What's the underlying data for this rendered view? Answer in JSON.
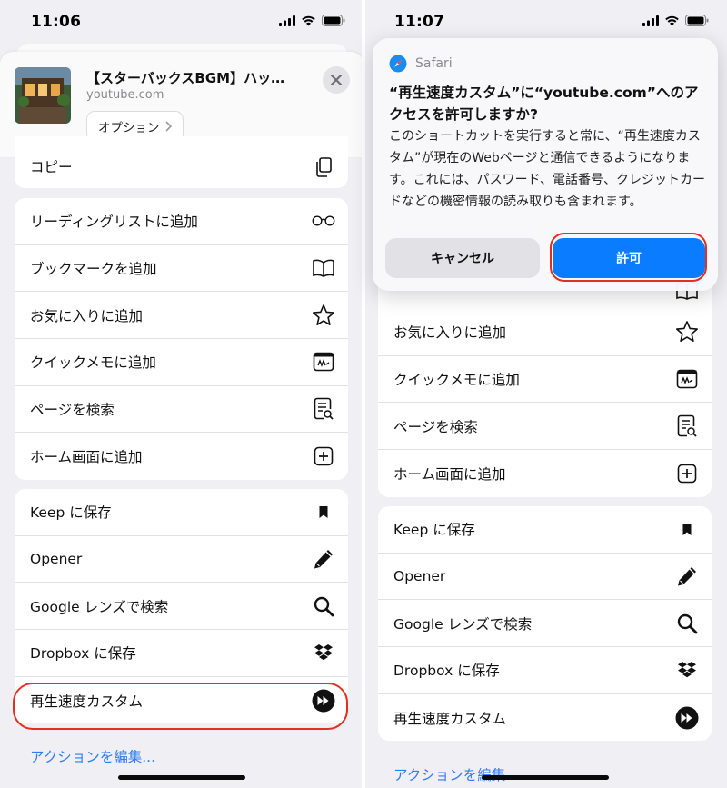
{
  "left": {
    "status": {
      "time": "11:06"
    },
    "header": {
      "title": "【スターバックスBGM】ハッピ…",
      "domain": "youtube.com",
      "options_label": "オプション"
    },
    "copy_label": "コピー",
    "group1": [
      {
        "label": "リーディングリストに追加",
        "icon": "glasses-icon"
      },
      {
        "label": "ブックマークを追加",
        "icon": "book-icon"
      },
      {
        "label": "お気に入りに追加",
        "icon": "star-icon"
      },
      {
        "label": "クイックメモに追加",
        "icon": "quick-note-icon"
      },
      {
        "label": "ページを検索",
        "icon": "find-on-page-icon"
      },
      {
        "label": "ホーム画面に追加",
        "icon": "add-square-icon"
      }
    ],
    "group2": [
      {
        "label": "Keep に保存",
        "icon": "bookmark-filled-icon"
      },
      {
        "label": "Opener",
        "icon": "pencil-icon"
      },
      {
        "label": "Google レンズで検索",
        "icon": "search-icon"
      },
      {
        "label": "Dropbox に保存",
        "icon": "dropbox-icon"
      },
      {
        "label": "再生速度カスタム",
        "icon": "fast-forward-circle-icon"
      }
    ],
    "edit_actions": "アクションを編集..."
  },
  "right": {
    "status": {
      "time": "11:07"
    },
    "dialog": {
      "app_name": "Safari",
      "title": "“再生速度カスタム”に“youtube.com”へのアクセスを許可しますか?",
      "body": "このショートカットを実行すると常に、“再生速度カスタム”が現在のWebページと通信できるようになります。これには、パスワード、電話番号、クレジットカードなどの機密情報の読み取りも含まれます。",
      "cancel_label": "キャンセル",
      "allow_label": "許可"
    },
    "group1": [
      {
        "label": "お気に入りに追加",
        "icon": "star-icon"
      },
      {
        "label": "クイックメモに追加",
        "icon": "quick-note-icon"
      },
      {
        "label": "ページを検索",
        "icon": "find-on-page-icon"
      },
      {
        "label": "ホーム画面に追加",
        "icon": "add-square-icon"
      }
    ],
    "group2": [
      {
        "label": "Keep に保存",
        "icon": "bookmark-filled-icon"
      },
      {
        "label": "Opener",
        "icon": "pencil-icon"
      },
      {
        "label": "Google レンズで検索",
        "icon": "search-icon"
      },
      {
        "label": "Dropbox に保存",
        "icon": "dropbox-icon"
      },
      {
        "label": "再生速度カスタム",
        "icon": "fast-forward-circle-icon"
      }
    ],
    "edit_actions": "アクションを編集..."
  },
  "colors": {
    "accent": "#0a7cff",
    "link": "#2f7cf6",
    "highlight": "#e0301e",
    "background": "#efeff4"
  }
}
